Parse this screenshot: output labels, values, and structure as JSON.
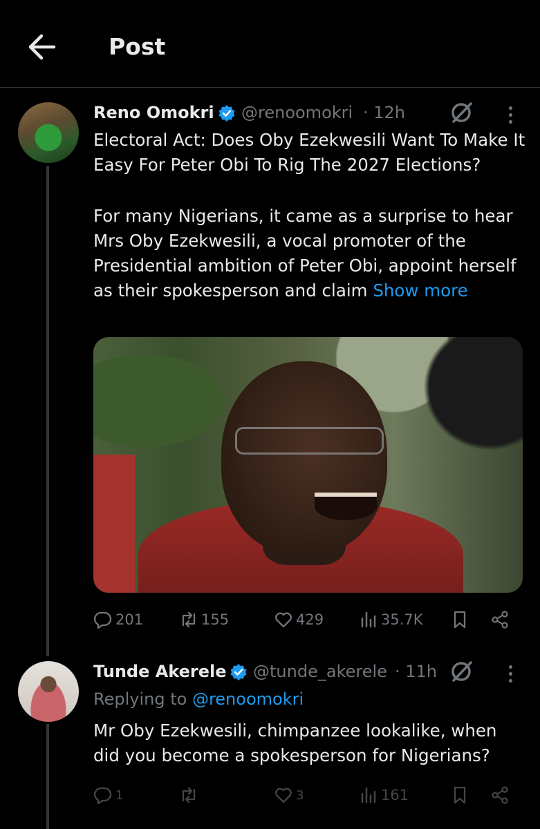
{
  "header": {
    "title": "Post",
    "back_icon": "arrow-left-icon"
  },
  "colors": {
    "background": "#000000",
    "text": "#e7e9ea",
    "muted": "#71767b",
    "link": "#1d9bf0",
    "verified": "#1d9bf0",
    "divider": "#2f3336"
  },
  "main_post": {
    "author_name": "Reno Omokri",
    "handle": "@renoomokri",
    "time": "· 12h",
    "text_line1": "Electoral Act: Does Oby Ezekwesili Want To Make It Easy For Peter Obi To Rig The 2027 Elections?",
    "text_body": "For many Nigerians, it came as a surprise to hear Mrs Oby Ezekwesili, a vocal promoter of the Presidential ambition of Peter Obi, appoint herself as their spokesperson and claim ",
    "show_more": "Show more",
    "stats": {
      "replies": "201",
      "reposts": "155",
      "likes": "429",
      "views": "35.7K"
    }
  },
  "reply_post": {
    "author_name": "Tunde Akerele",
    "handle": "@tunde_akerele",
    "time": "· 11h",
    "replying_prefix": "Replying to ",
    "replying_to": "@renoomokri",
    "text": "Mr Oby Ezekwesili, chimpanzee lookalike, when did you become a spokesperson for Nigerians?",
    "stats": {
      "replies": "1",
      "reposts": "",
      "likes": "3",
      "views": "161"
    }
  }
}
